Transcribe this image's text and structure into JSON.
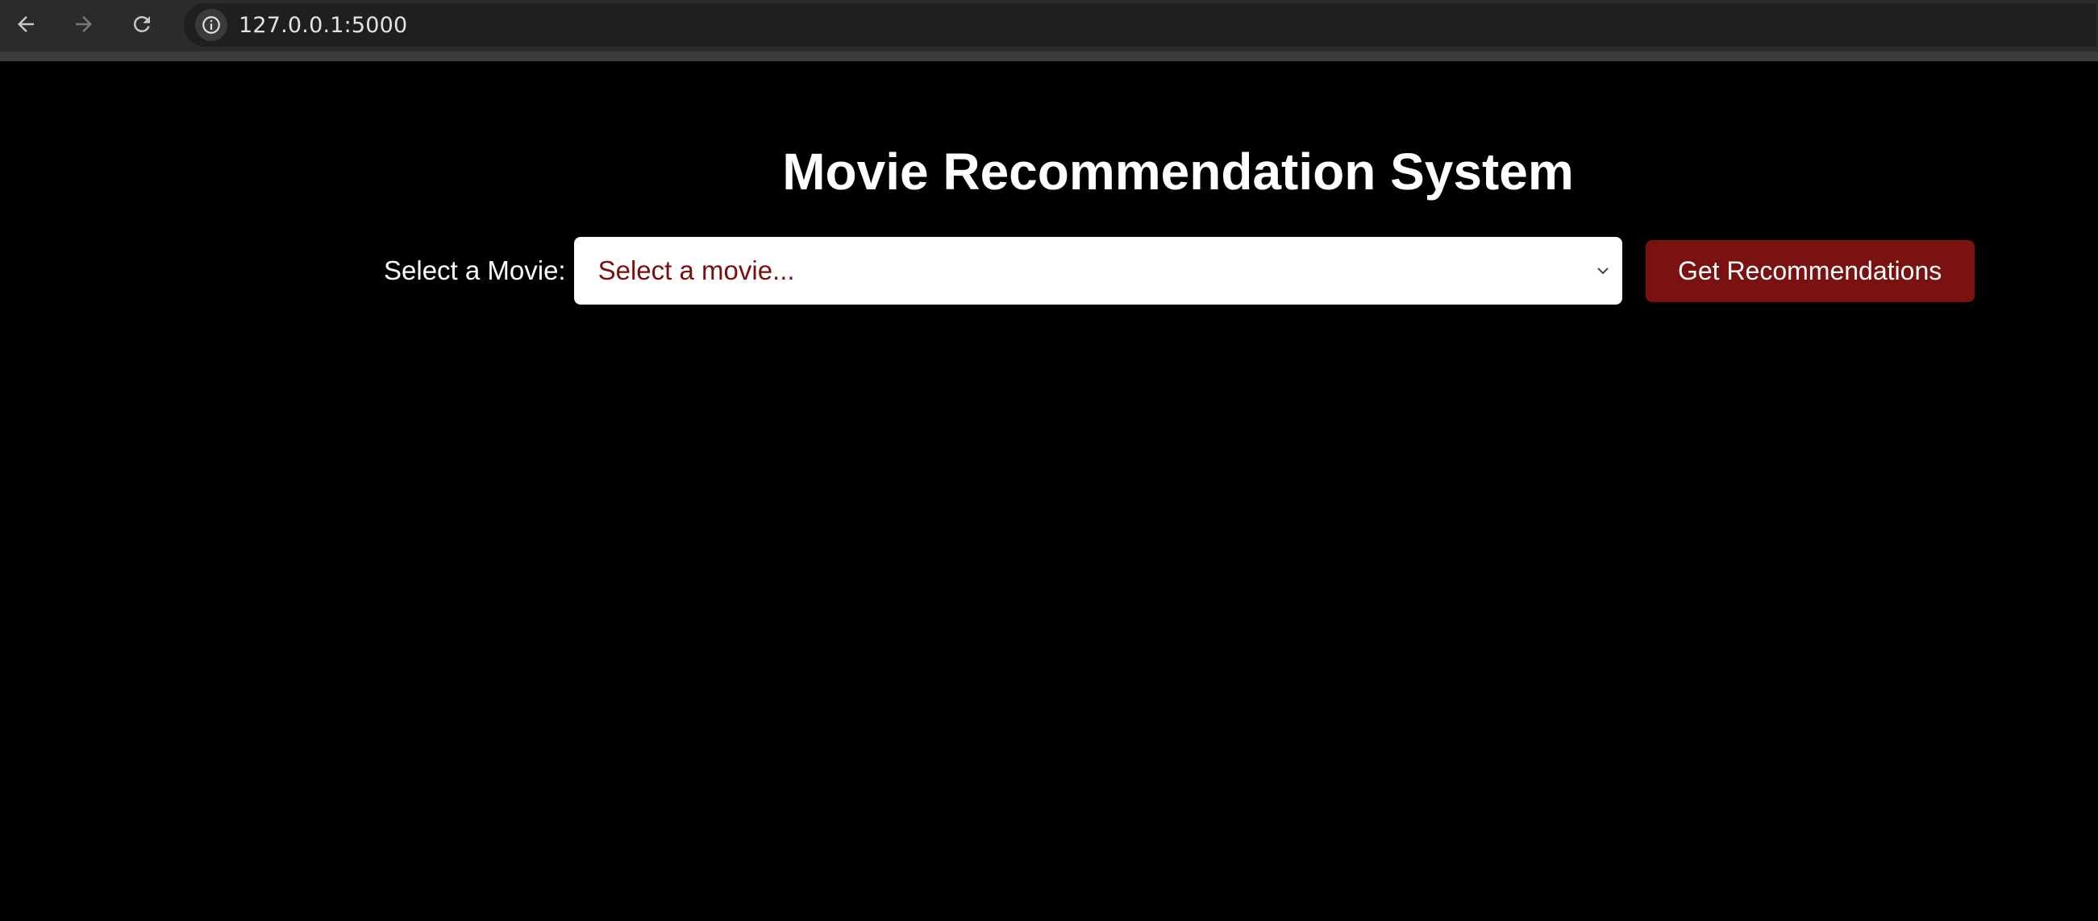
{
  "browser": {
    "url": "127.0.0.1:5000",
    "icons": {
      "back": "arrow-left-icon",
      "forward": "arrow-right-icon",
      "reload": "reload-icon",
      "site_info": "info-icon"
    }
  },
  "page": {
    "title": "Movie Recommendation System",
    "form": {
      "label": "Select a Movie:",
      "select_placeholder": "Select a movie...",
      "button_label": "Get Recommendations"
    }
  },
  "colors": {
    "background": "#000000",
    "accent": "#7a1212",
    "placeholder_text": "#7b0e0e",
    "text": "#ffffff"
  }
}
